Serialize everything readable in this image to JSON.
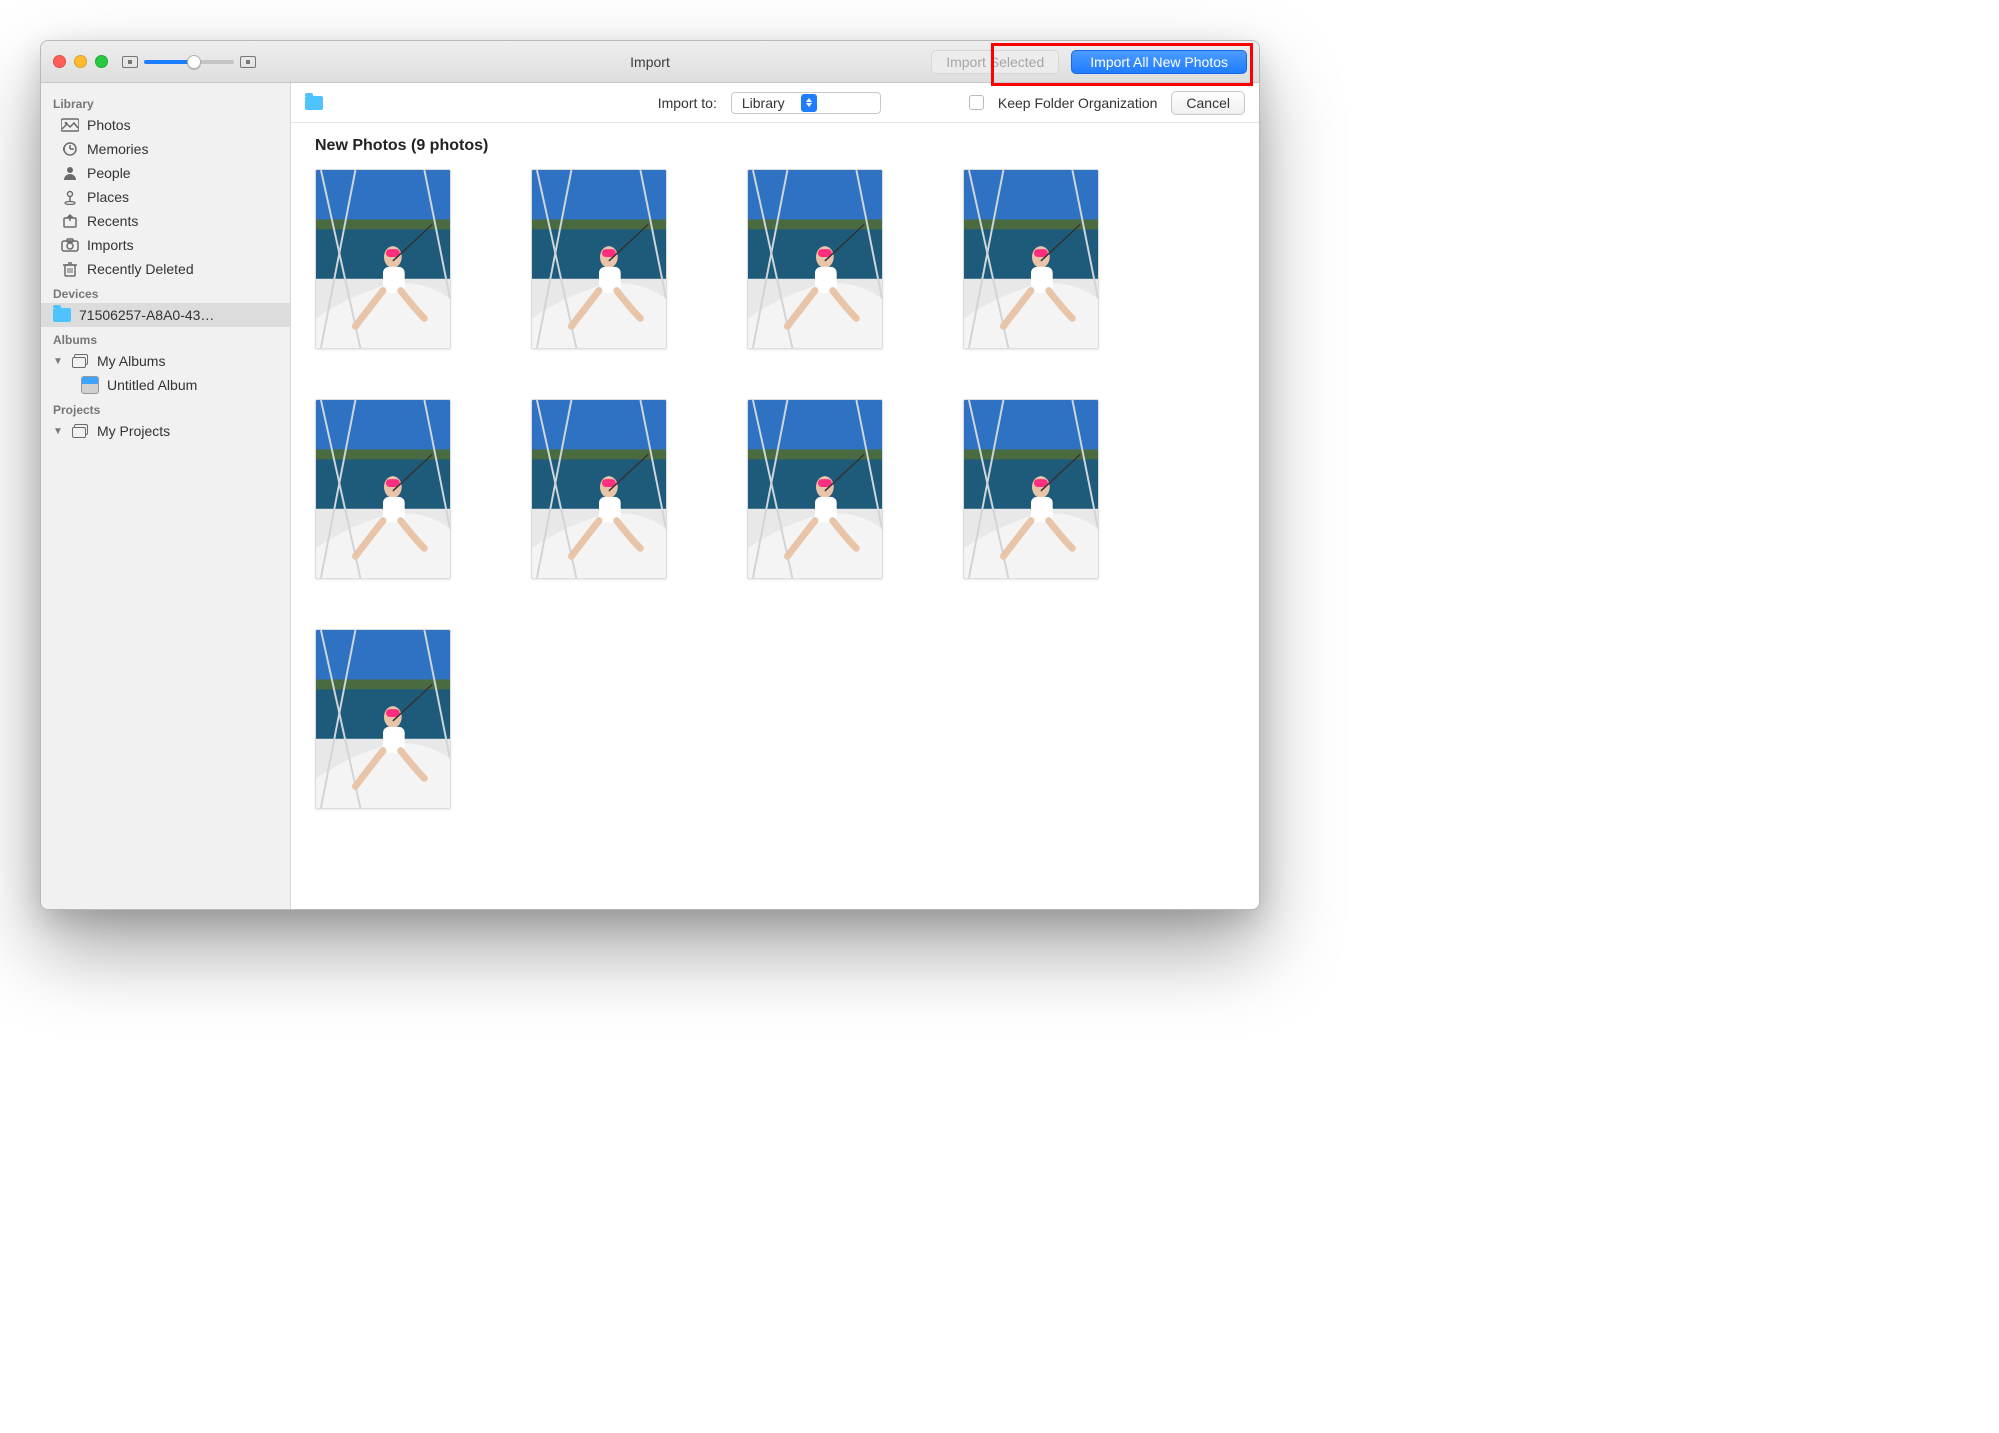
{
  "titlebar": {
    "title": "Import",
    "import_selected": "Import Selected",
    "import_all": "Import All New Photos"
  },
  "toolbar": {
    "import_to_label": "Import to:",
    "import_to_value": "Library",
    "keep_folder_label": "Keep Folder Organization",
    "cancel": "Cancel"
  },
  "content": {
    "group_title": "New Photos (9 photos)",
    "photo_count": 9
  },
  "sidebar": {
    "sections": {
      "library": "Library",
      "devices": "Devices",
      "albums": "Albums",
      "projects": "Projects"
    },
    "library_items": [
      {
        "label": "Photos",
        "icon": "photos"
      },
      {
        "label": "Memories",
        "icon": "memories"
      },
      {
        "label": "People",
        "icon": "people"
      },
      {
        "label": "Places",
        "icon": "places"
      },
      {
        "label": "Recents",
        "icon": "recents"
      },
      {
        "label": "Imports",
        "icon": "imports"
      },
      {
        "label": "Recently Deleted",
        "icon": "trash"
      }
    ],
    "device_item": {
      "label": "71506257-A8A0-43…"
    },
    "my_albums": "My Albums",
    "untitled_album": "Untitled Album",
    "my_projects": "My Projects"
  }
}
